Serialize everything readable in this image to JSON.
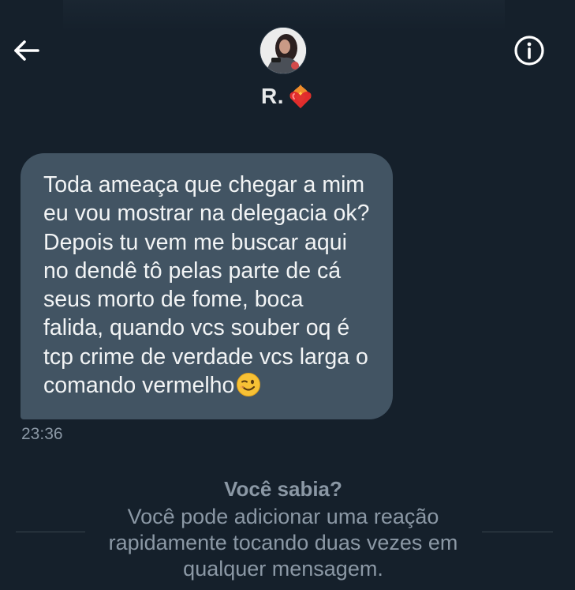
{
  "header": {
    "back_icon": "arrow-left-icon",
    "info_icon": "info-circle-icon",
    "contact_name": "R.",
    "contact_emoji": "heart-on-fire-icon"
  },
  "conversation": {
    "messages": [
      {
        "text": "Toda ameaça que chegar a mim\neu vou mostrar na delegacia ok?\nDepois tu vem me buscar aqui\nno dendê tô pelas parte de cá\nseus morto de fome, boca\nfalida, quando vcs souber oq é\ntcp crime de verdade vcs larga o\ncomando vermelho",
        "trailing_emoji": "winking-face-icon",
        "time": "23:36"
      }
    ]
  },
  "tip": {
    "title": "Você sabia?",
    "body": "Você pode adicionar uma reação rapidamente tocando duas vezes em qualquer mensagem."
  },
  "colors": {
    "background": "#15202b",
    "bubble": "#425463",
    "text_primary": "#e7e9ea",
    "text_secondary": "#8b98a5"
  }
}
